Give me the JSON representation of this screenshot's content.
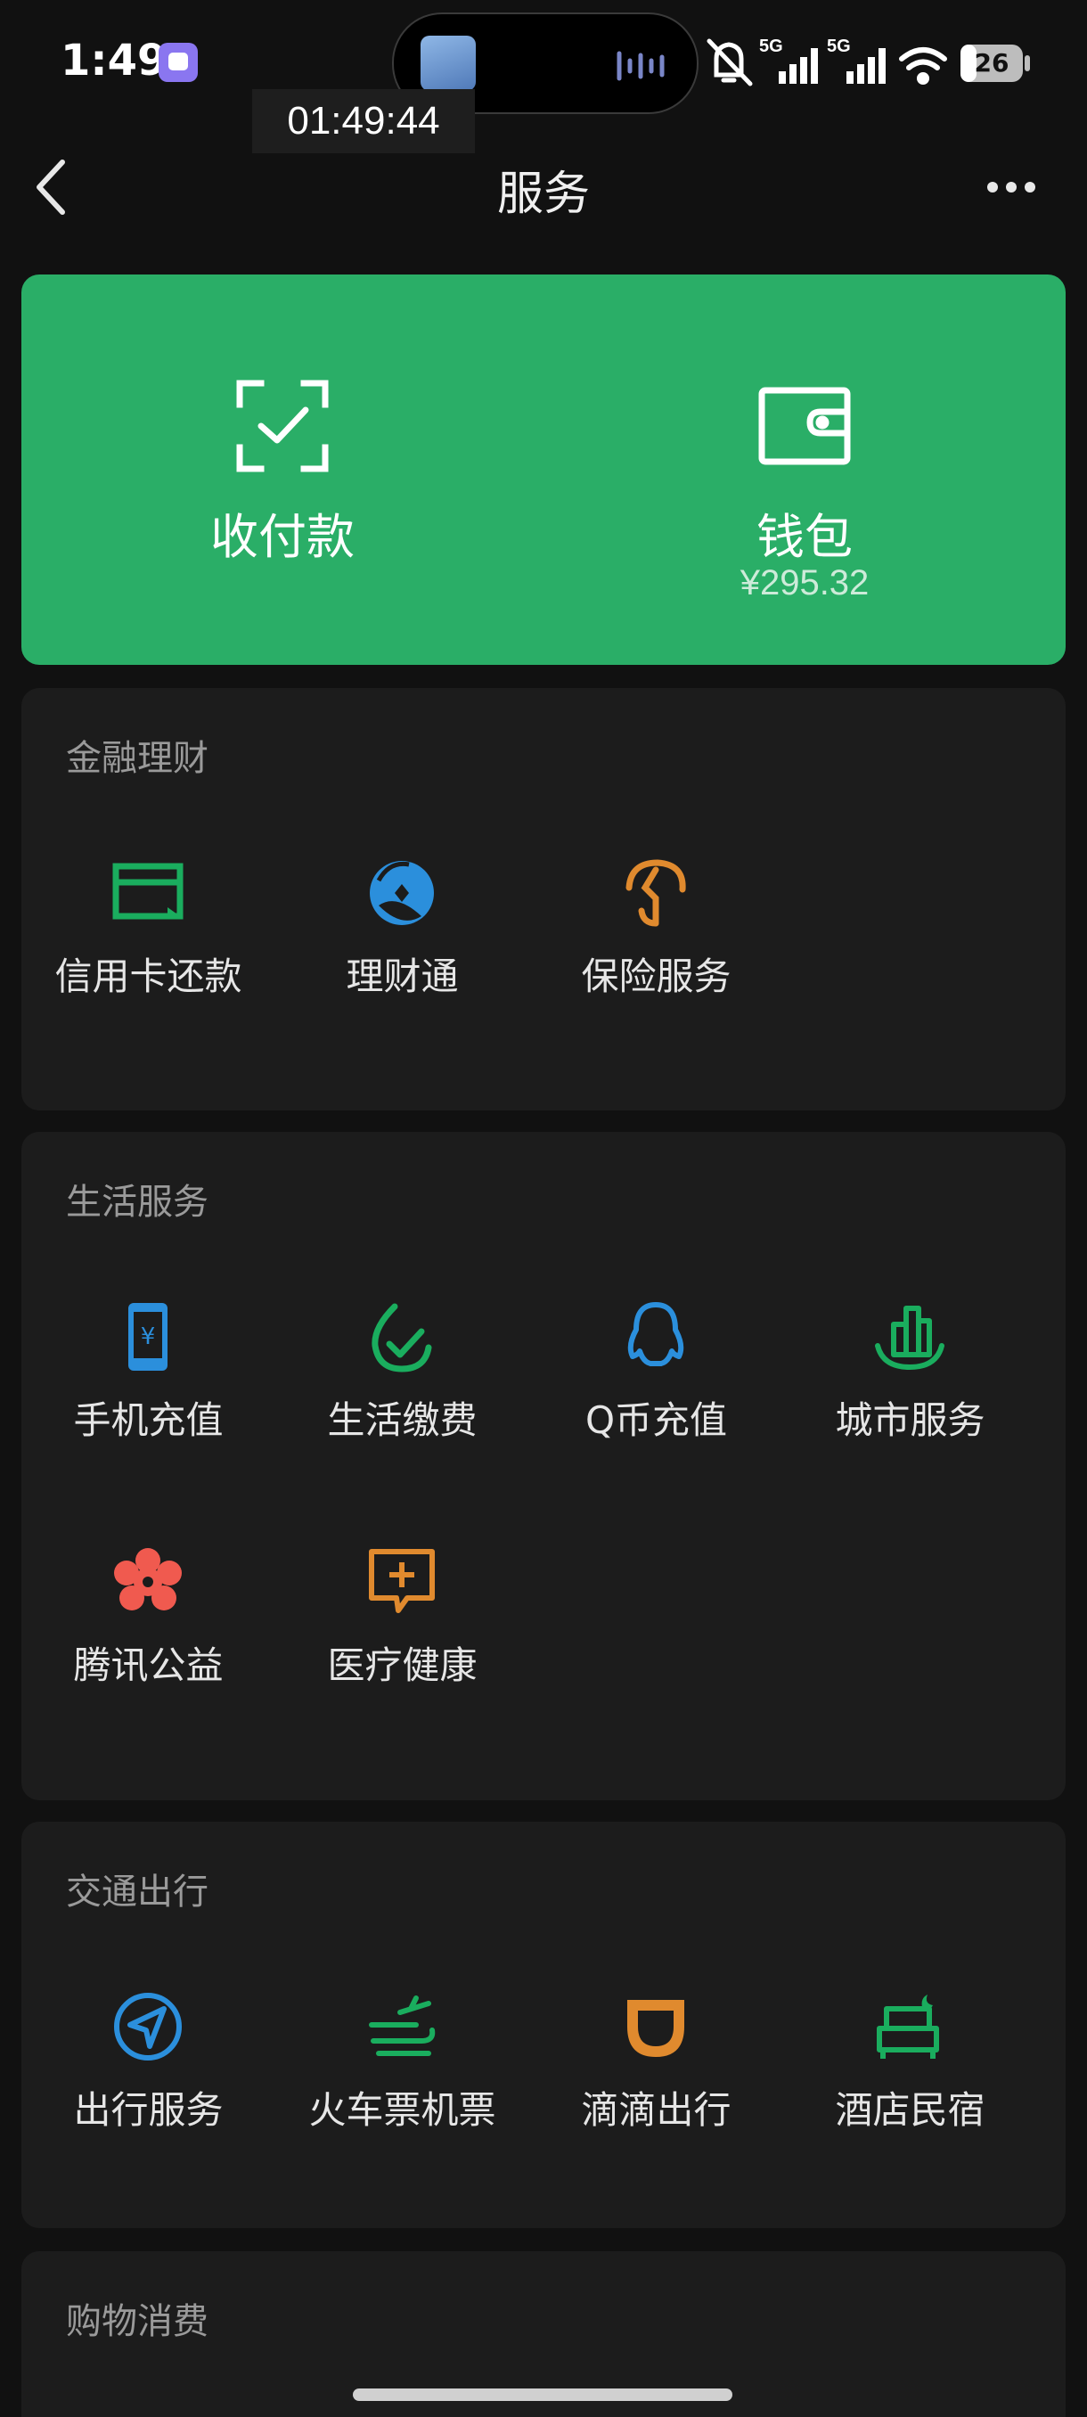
{
  "status": {
    "time": "1:49",
    "recording_time": "01:49:44",
    "battery": "26",
    "network_1": "5G",
    "network_2": "5G"
  },
  "nav": {
    "title": "服务"
  },
  "payment": {
    "pay_label": "收付款",
    "wallet_label": "钱包",
    "wallet_balance": "¥295.32",
    "colors": {
      "card": "#2aae67"
    }
  },
  "sections": {
    "finance": {
      "title": "金融理财",
      "items": [
        "信用卡还款",
        "理财通",
        "保险服务"
      ]
    },
    "life": {
      "title": "生活服务",
      "items": [
        "手机充值",
        "生活缴费",
        "Q币充值",
        "城市服务",
        "腾讯公益",
        "医疗健康"
      ]
    },
    "travel": {
      "title": "交通出行",
      "items": [
        "出行服务",
        "火车票机票",
        "滴滴出行",
        "酒店民宿"
      ]
    },
    "shopping": {
      "title": "购物消费"
    }
  },
  "icons": {
    "finance": [
      "credit-card-icon",
      "wealth-icon",
      "insurance-icon"
    ],
    "life": [
      "phone-topup-icon",
      "utility-bill-icon",
      "qq-coin-icon",
      "city-service-icon",
      "charity-icon",
      "medical-icon"
    ],
    "travel": [
      "travel-icon",
      "train-plane-icon",
      "didi-icon",
      "hotel-icon"
    ]
  }
}
